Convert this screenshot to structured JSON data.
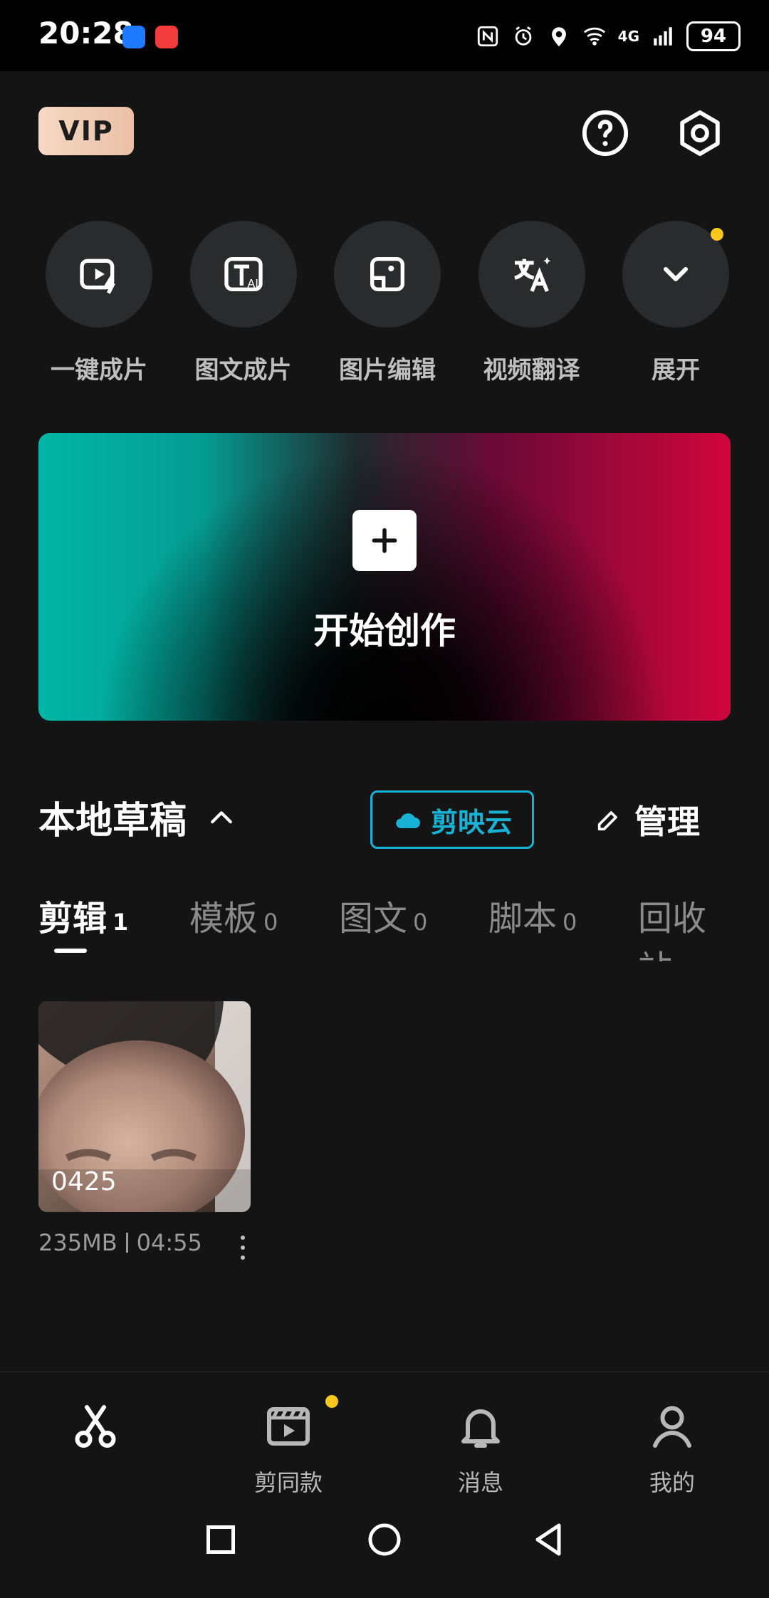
{
  "status_bar": {
    "time": "20:28",
    "battery": "94",
    "network": "4G",
    "icons": [
      "nfc-icon",
      "alarm-icon",
      "location-icon",
      "wifi-icon",
      "signal-icon"
    ]
  },
  "header": {
    "vip_label": "VIP",
    "help_icon": "help-icon",
    "settings_icon": "settings-icon"
  },
  "quick_actions": [
    {
      "label": "一键成片",
      "icon": "video-lightning-icon"
    },
    {
      "label": "图文成片",
      "icon": "text-ai-icon"
    },
    {
      "label": "图片编辑",
      "icon": "image-edit-icon"
    },
    {
      "label": "视频翻译",
      "icon": "translate-icon"
    },
    {
      "label": "展开",
      "icon": "chevron-down-icon"
    }
  ],
  "hero": {
    "title": "开始创作"
  },
  "drafts": {
    "title": "本地草稿",
    "cloud_label": "剪映云",
    "manage_label": "管理",
    "tabs": [
      {
        "label": "剪辑",
        "count": "1"
      },
      {
        "label": "模板",
        "count": "0"
      },
      {
        "label": "图文",
        "count": "0"
      },
      {
        "label": "脚本",
        "count": "0"
      },
      {
        "label": "回收站",
        "count": ""
      }
    ],
    "items": [
      {
        "name": "0425",
        "size": "235MB",
        "duration": "04:55"
      }
    ]
  },
  "bottom_nav": [
    {
      "label": "",
      "icon": "scissors-icon",
      "active": true
    },
    {
      "label": "剪同款",
      "icon": "template-icon"
    },
    {
      "label": "消息",
      "icon": "bell-icon"
    },
    {
      "label": "我的",
      "icon": "user-icon"
    }
  ],
  "colors": {
    "background": "#141414",
    "accent_teal": "#19b2d5",
    "active_underline": "#f04164",
    "notification_dot": "#f8c81c"
  }
}
